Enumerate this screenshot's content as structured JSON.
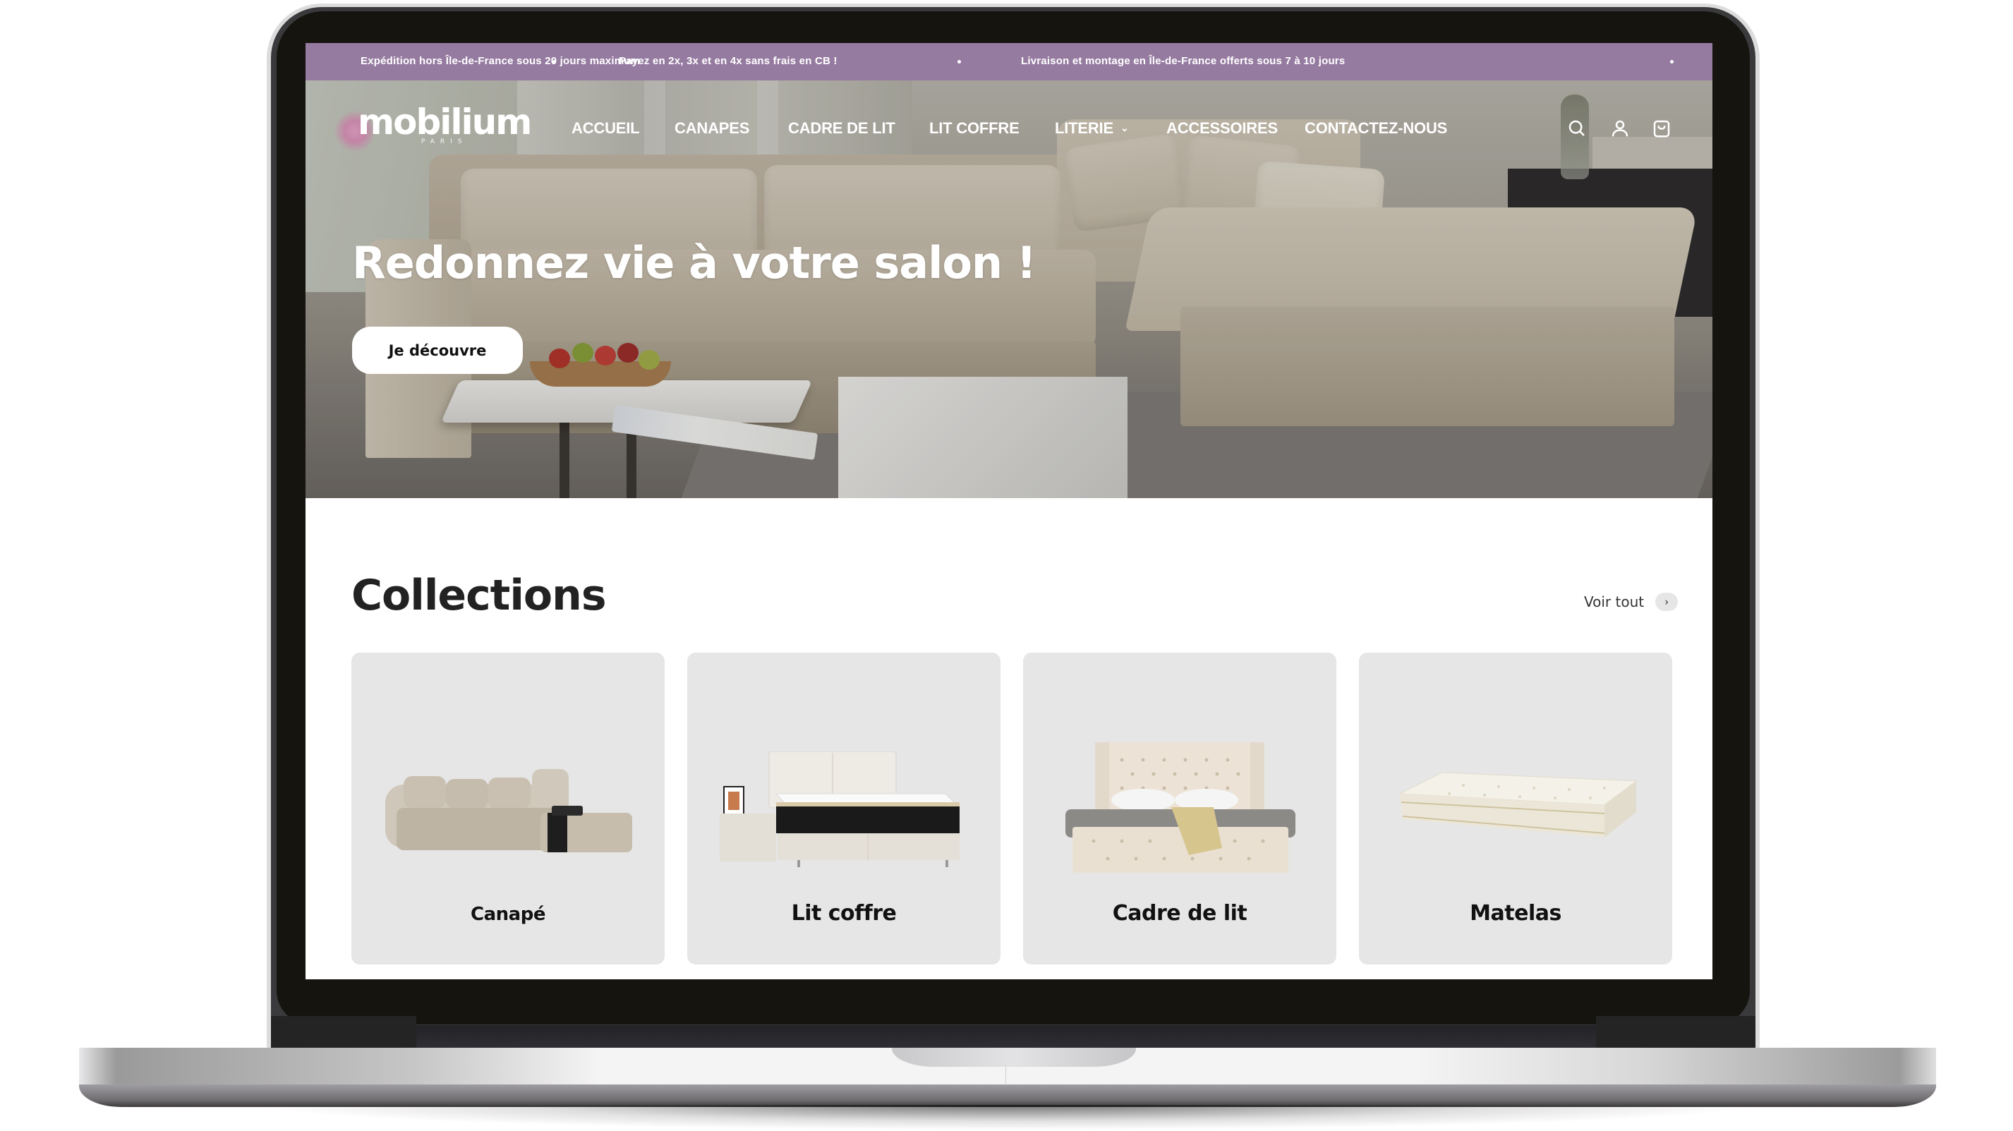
{
  "announcement_bar": {
    "background": "#967ba1",
    "messages": [
      "Expédition hors Île-de-France sous 20 jours maximum",
      "Payez en 2x, 3x et en 4x sans frais en CB !",
      "Livraison et montage en Île-de-France offerts sous 7 à 10 jours"
    ]
  },
  "header": {
    "logo": {
      "name": "mobilium",
      "tagline": "PARIS"
    },
    "nav": [
      {
        "label": "ACCUEIL"
      },
      {
        "label": "CANAPES"
      },
      {
        "label": "CADRE DE LIT"
      },
      {
        "label": "LIT COFFRE"
      },
      {
        "label": "LITERIE",
        "has_dropdown": true,
        "chevron": "⌄"
      },
      {
        "label": "ACCESSOIRES"
      },
      {
        "label": "CONTACTEZ-NOUS"
      }
    ],
    "icons": [
      "search-icon",
      "account-icon",
      "cart-icon"
    ]
  },
  "hero": {
    "title": "Redonnez vie à votre salon !",
    "cta_label": "Je découvre"
  },
  "collections": {
    "title": "Collections",
    "see_all_label": "Voir tout",
    "see_all_arrow": "›",
    "items": [
      {
        "label": "Canapé",
        "image": "sofa"
      },
      {
        "label": "Lit coffre",
        "image": "storage-bed"
      },
      {
        "label": "Cadre de lit",
        "image": "tufted-bed-frame"
      },
      {
        "label": "Matelas",
        "image": "mattress"
      }
    ],
    "card_background": "#e6e6e6"
  }
}
